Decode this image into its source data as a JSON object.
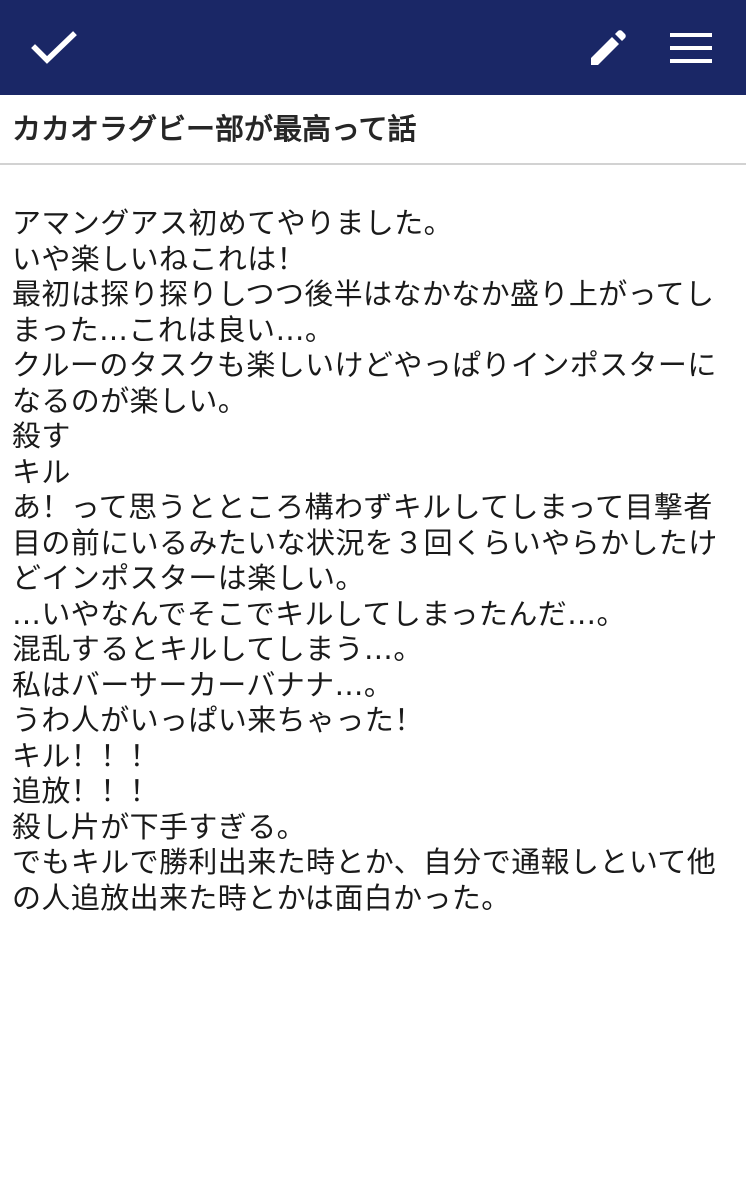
{
  "toolbar": {
    "confirm_icon": "check-icon",
    "edit_icon": "pencil-icon",
    "menu_icon": "hamburger-menu-icon",
    "background_color": "#1a2766"
  },
  "note": {
    "title": "カカオラグビー部が最高って話",
    "lines": [
      "アマングアス初めてやりました。",
      "いや楽しいねこれは！",
      "最初は探り探りしつつ後半はなかなか盛り上がってし",
      "まった…これは良い…。",
      "クルーのタスクも楽しいけどやっぱりインポスターに",
      "なるのが楽しい。",
      "殺す",
      "キル",
      "あ！って思うとところ構わずキルしてしまって目撃者",
      "目の前にいるみたいな状況を３回くらいやらかしたけ",
      "どインポスターは楽しい。",
      "…いやなんでそこでキルしてしまったんだ…。",
      "混乱するとキルしてしまう…。",
      "私はバーサーカーバナナ…。",
      "うわ人がいっぱい来ちゃった！",
      "キル！！！",
      "追放！！！",
      "殺し片が下手すぎる。",
      "でもキルで勝利出来た時とか、自分で通報しといて他",
      "の人追放出来た時とかは面白かった。"
    ]
  }
}
